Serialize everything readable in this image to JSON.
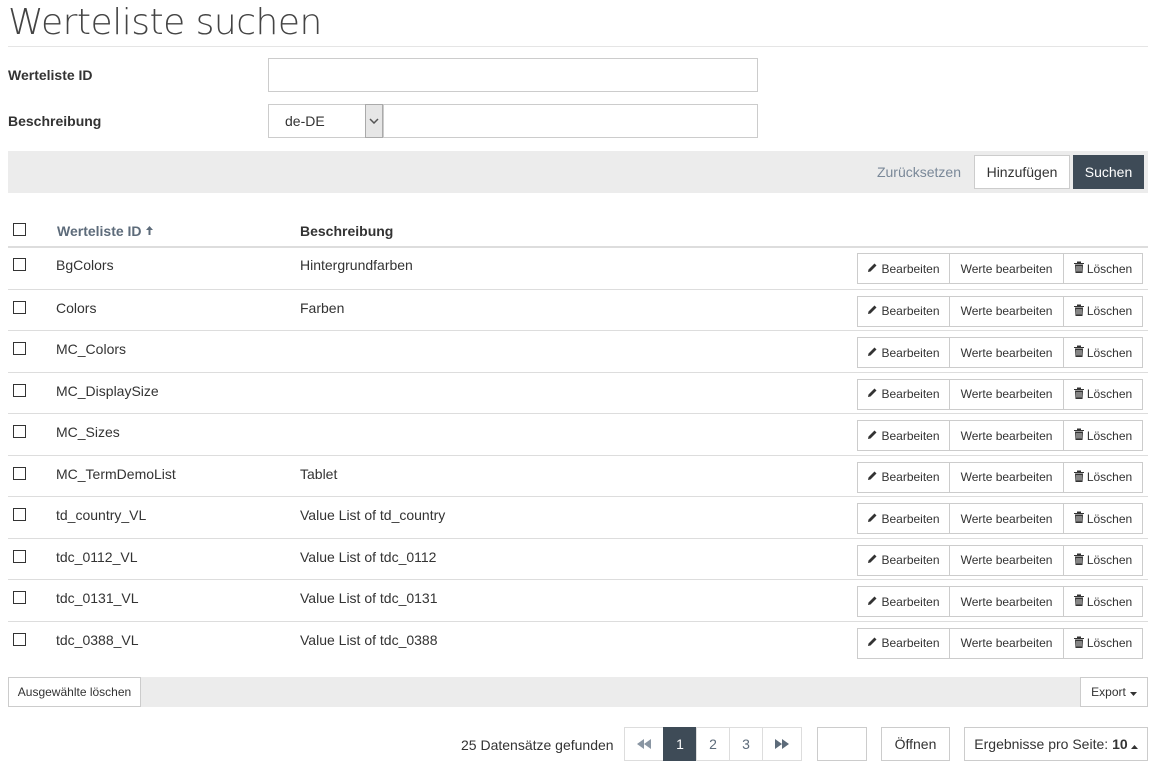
{
  "page": {
    "title": "Werteliste suchen"
  },
  "form": {
    "id_label": "Werteliste ID",
    "id_value": "",
    "description_label": "Beschreibung",
    "language_selected": "de-DE",
    "description_value": ""
  },
  "toolbar": {
    "reset_label": "Zurücksetzen",
    "add_label": "Hinzufügen",
    "search_label": "Suchen"
  },
  "table": {
    "columns": [
      "Werteliste ID",
      "Beschreibung"
    ],
    "row_actions": {
      "edit": "Bearbeiten",
      "edit_values": "Werte bearbeiten",
      "delete": "Löschen"
    },
    "rows": [
      {
        "id": "BgColors",
        "description": "Hintergrundfarben"
      },
      {
        "id": "Colors",
        "description": "Farben"
      },
      {
        "id": "MC_Colors",
        "description": ""
      },
      {
        "id": "MC_DisplaySize",
        "description": ""
      },
      {
        "id": "MC_Sizes",
        "description": ""
      },
      {
        "id": "MC_TermDemoList",
        "description": "Tablet"
      },
      {
        "id": "td_country_VL",
        "description": "Value List of td_country"
      },
      {
        "id": "tdc_0112_VL",
        "description": "Value List of tdc_0112"
      },
      {
        "id": "tdc_0131_VL",
        "description": "Value List of tdc_0131"
      },
      {
        "id": "tdc_0388_VL",
        "description": "Value List of tdc_0388"
      }
    ]
  },
  "footer": {
    "delete_selected_label": "Ausgewählte löschen",
    "export_label": "Export"
  },
  "pagination": {
    "found_text": "25 Datensätze gefunden",
    "pages": [
      "1",
      "2",
      "3"
    ],
    "current_page": "1",
    "goto_value": "",
    "open_label": "Öffnen",
    "per_page_label": "Ergebnisse pro Seite:",
    "per_page_value": "10"
  },
  "colors": {
    "accent_dark": "#3e4b57",
    "toolbar_bg": "#ececec",
    "border": "#cccccc"
  }
}
